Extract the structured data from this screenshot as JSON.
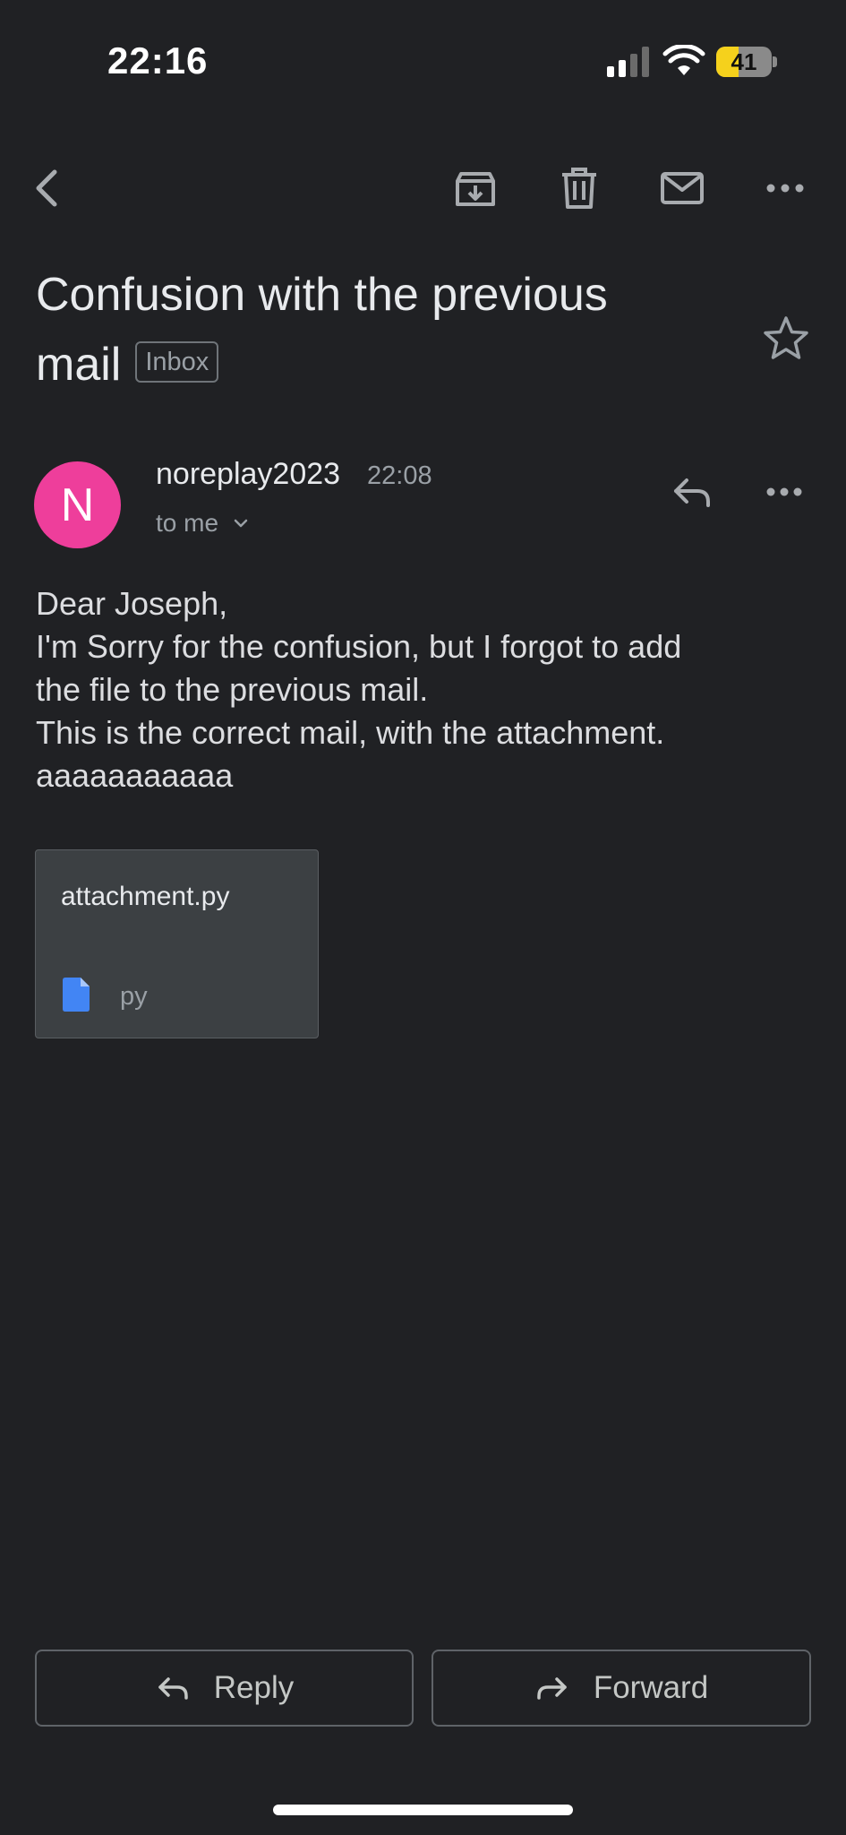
{
  "status_bar": {
    "time": "22:16",
    "battery_level": "41",
    "battery_fraction": 0.41,
    "signal_icon": "cellular-signal-icon",
    "wifi_icon": "wifi-icon"
  },
  "toolbar": {
    "back_icon": "chevron-left-icon",
    "archive_icon": "archive-icon",
    "delete_icon": "trash-icon",
    "mark_unread_icon": "envelope-icon",
    "more_icon": "more-horizontal-icon"
  },
  "email": {
    "subject_line1": "Confusion with the previous",
    "subject_line2": "mail",
    "label": "Inbox",
    "sender_initial": "N",
    "sender": "noreplay2023",
    "time": "22:08",
    "recipient": "to me",
    "body_lines": [
      "Dear Joseph,",
      "I'm Sorry for the confusion, but I forgot to add",
      "the file to the previous mail.",
      "This is the correct mail, with the attachment.",
      "aaaaaaaaaaa"
    ],
    "attachment": {
      "name": "attachment.py",
      "type": "py",
      "icon": "file-icon"
    }
  },
  "actions": {
    "reply_label": "Reply",
    "forward_label": "Forward"
  },
  "colors": {
    "background": "#202124",
    "avatar": "#ee3e9b",
    "battery_fill": "#f5d11c",
    "file_icon": "#4285f4"
  }
}
